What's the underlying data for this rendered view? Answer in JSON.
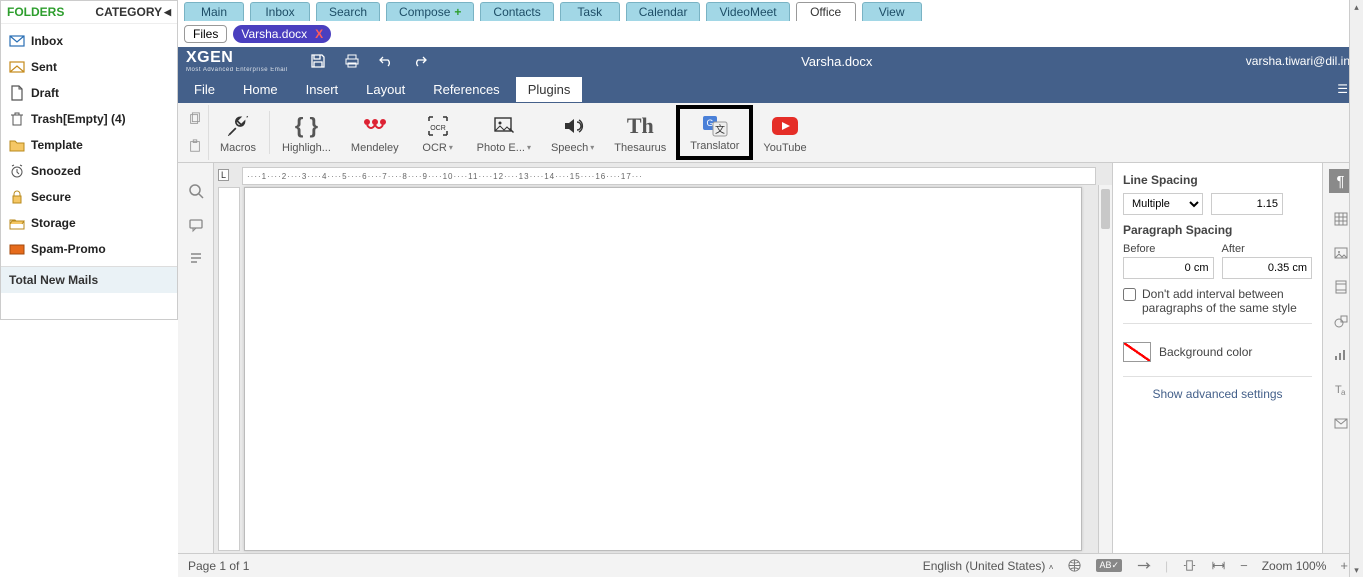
{
  "sidebar": {
    "header": {
      "folders": "FOLDERS",
      "category": "CATEGORY"
    },
    "items": [
      {
        "label": "Inbox"
      },
      {
        "label": "Sent"
      },
      {
        "label": "Draft"
      },
      {
        "label": "Trash[Empty] (4)"
      },
      {
        "label": "Template"
      },
      {
        "label": "Snoozed"
      },
      {
        "label": "Secure"
      },
      {
        "label": "Storage"
      },
      {
        "label": "Spam-Promo"
      }
    ],
    "footer": "Total New Mails"
  },
  "toptabs": [
    {
      "label": "Main"
    },
    {
      "label": "Inbox"
    },
    {
      "label": "Search"
    },
    {
      "label": "Compose"
    },
    {
      "label": "Contacts"
    },
    {
      "label": "Task"
    },
    {
      "label": "Calendar"
    },
    {
      "label": "VideoMeet"
    },
    {
      "label": "Office"
    },
    {
      "label": "View"
    }
  ],
  "filesrow": {
    "files_btn": "Files",
    "open_file": "Varsha.docx"
  },
  "editor": {
    "logo": "XGEN",
    "logo_sub": "Most Advanced Enterprise Email",
    "doc_title": "Varsha.docx",
    "user": "varsha.tiwari@dil.in"
  },
  "menubar": [
    "File",
    "Home",
    "Insert",
    "Layout",
    "References",
    "Plugins"
  ],
  "menubar_active": "Plugins",
  "ribbon": [
    {
      "label": "Macros"
    },
    {
      "label": "Highligh..."
    },
    {
      "label": "Mendeley"
    },
    {
      "label": "OCR",
      "dropdown": true
    },
    {
      "label": "Photo E...",
      "dropdown": true
    },
    {
      "label": "Speech",
      "dropdown": true
    },
    {
      "label": "Thesaurus"
    },
    {
      "label": "Translator",
      "highlighted": true
    },
    {
      "label": "YouTube"
    }
  ],
  "ruler_text": "····1····2····3····4····5····6····7····8····9····10····11····12····13····14····15····16····17···",
  "right_panel": {
    "line_spacing_label": "Line Spacing",
    "line_spacing_mode": "Multiple",
    "line_spacing_value": "1.15",
    "para_spacing_label": "Paragraph Spacing",
    "before_label": "Before",
    "after_label": "After",
    "before_value": "0 cm",
    "after_value": "0.35 cm",
    "no_interval_label": "Don't add interval between paragraphs of the same style",
    "bg_label": "Background color",
    "advanced": "Show advanced settings"
  },
  "statusbar": {
    "page": "Page 1 of 1",
    "lang": "English (United States)",
    "zoom": "Zoom 100%"
  }
}
